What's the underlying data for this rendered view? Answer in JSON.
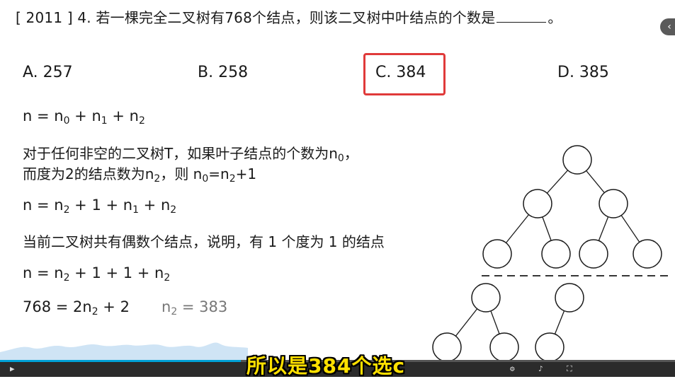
{
  "question": {
    "prefix": "[ 2011 ] 4. 若一棵完全二叉树有768个结点，则该二叉树中叶结点的个数是",
    "suffix": "。"
  },
  "options": [
    {
      "label": "A. 257"
    },
    {
      "label": "B. 258"
    },
    {
      "label": "C. 384",
      "highlighted": true
    },
    {
      "label": "D. 385"
    }
  ],
  "highlight_color": "#e03a3a",
  "formulas": {
    "f1": {
      "a": "n = n",
      "s0": "0",
      "b": " + n",
      "s1": "1",
      "c": " + n",
      "s2": "2"
    },
    "p1": {
      "a": "对于任何非空的二叉树T，如果叶子结点的个数为n",
      "s0": "0",
      "b": "，"
    },
    "p2": {
      "a": "而度为2的结点数为n",
      "s2": "2",
      "b": "，则 n",
      "s0": "0",
      "c": "=n",
      "s2b": "2",
      "d": "+1"
    },
    "f2": {
      "a": "n = n",
      "s2": "2",
      "b": " + 1 + n",
      "s1": "1",
      "c": " + n",
      "s2b": "2"
    },
    "p3": "当前二叉树共有偶数个结点，说明，有 1 个度为 1 的结点",
    "f3": {
      "a": "n = n",
      "s2": "2",
      "b": " + 1 + 1 + n",
      "s2b": "2"
    },
    "f4": {
      "a": "768 = 2n",
      "s2": "2",
      "b": " + 2"
    },
    "f5": {
      "a": "n",
      "s2": "2",
      "b": " = 383"
    }
  },
  "subtitle": "所以是384个选c",
  "player": {
    "accent": "#00a1d6",
    "subtitle_color": "#ffe000",
    "progress": 0.357
  }
}
